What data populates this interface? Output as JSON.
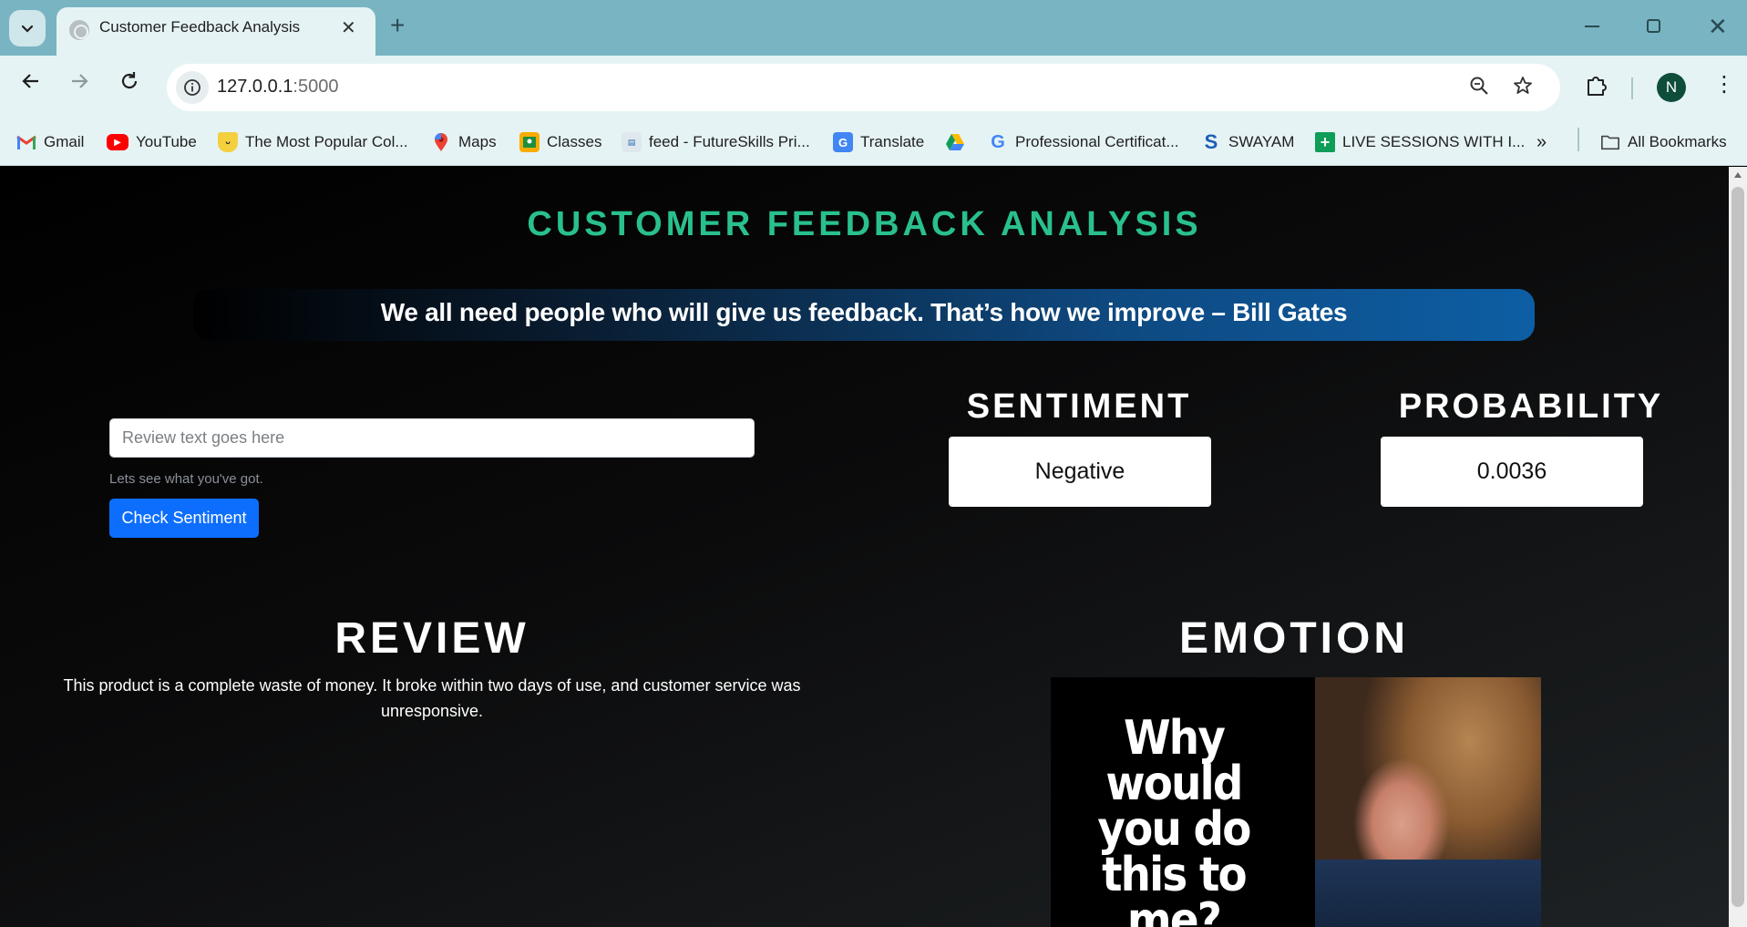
{
  "browser": {
    "tab_title": "Customer Feedback Analysis",
    "url_host": "127.0.0.1",
    "url_port": ":5000",
    "profile_initial": "N",
    "bookmarks": [
      {
        "label": "Gmail",
        "icon": "gmail-icon"
      },
      {
        "label": "YouTube",
        "icon": "youtube-icon"
      },
      {
        "label": "The Most Popular Col...",
        "icon": "cup-icon"
      },
      {
        "label": "Maps",
        "icon": "maps-icon"
      },
      {
        "label": "Classes",
        "icon": "classroom-icon"
      },
      {
        "label": "feed - FutureSkills Pri...",
        "icon": "futureskills-icon"
      },
      {
        "label": "Translate",
        "icon": "translate-icon"
      },
      {
        "label": "",
        "icon": "drive-icon"
      },
      {
        "label": "Professional Certificat...",
        "icon": "google-icon"
      },
      {
        "label": "SWAYAM",
        "icon": "swayam-icon"
      },
      {
        "label": "LIVE SESSIONS WITH I...",
        "icon": "sheets-icon"
      }
    ],
    "all_bookmarks_label": "All Bookmarks"
  },
  "page": {
    "title": "CUSTOMER FEEDBACK ANALYSIS",
    "quote": "We all need people who will give us feedback. That’s how we improve – Bill Gates",
    "form": {
      "input_placeholder": "Review text goes here",
      "help_text": "Lets see what you've got.",
      "button_label": "Check Sentiment"
    },
    "sentiment": {
      "heading": "SENTIMENT",
      "value": "Negative"
    },
    "probability": {
      "heading": "PROBABILITY",
      "value": "0.0036"
    },
    "review": {
      "heading": "REVIEW",
      "text": "This product is a complete waste of money. It broke within two days of use, and customer service was unresponsive."
    },
    "emotion": {
      "heading": "EMOTION",
      "meme_text": "Why would you do this to me?"
    }
  },
  "colors": {
    "title_green": "#29c08c",
    "button_blue": "#0d6efd",
    "banner_blue": "#0d5ea4"
  }
}
